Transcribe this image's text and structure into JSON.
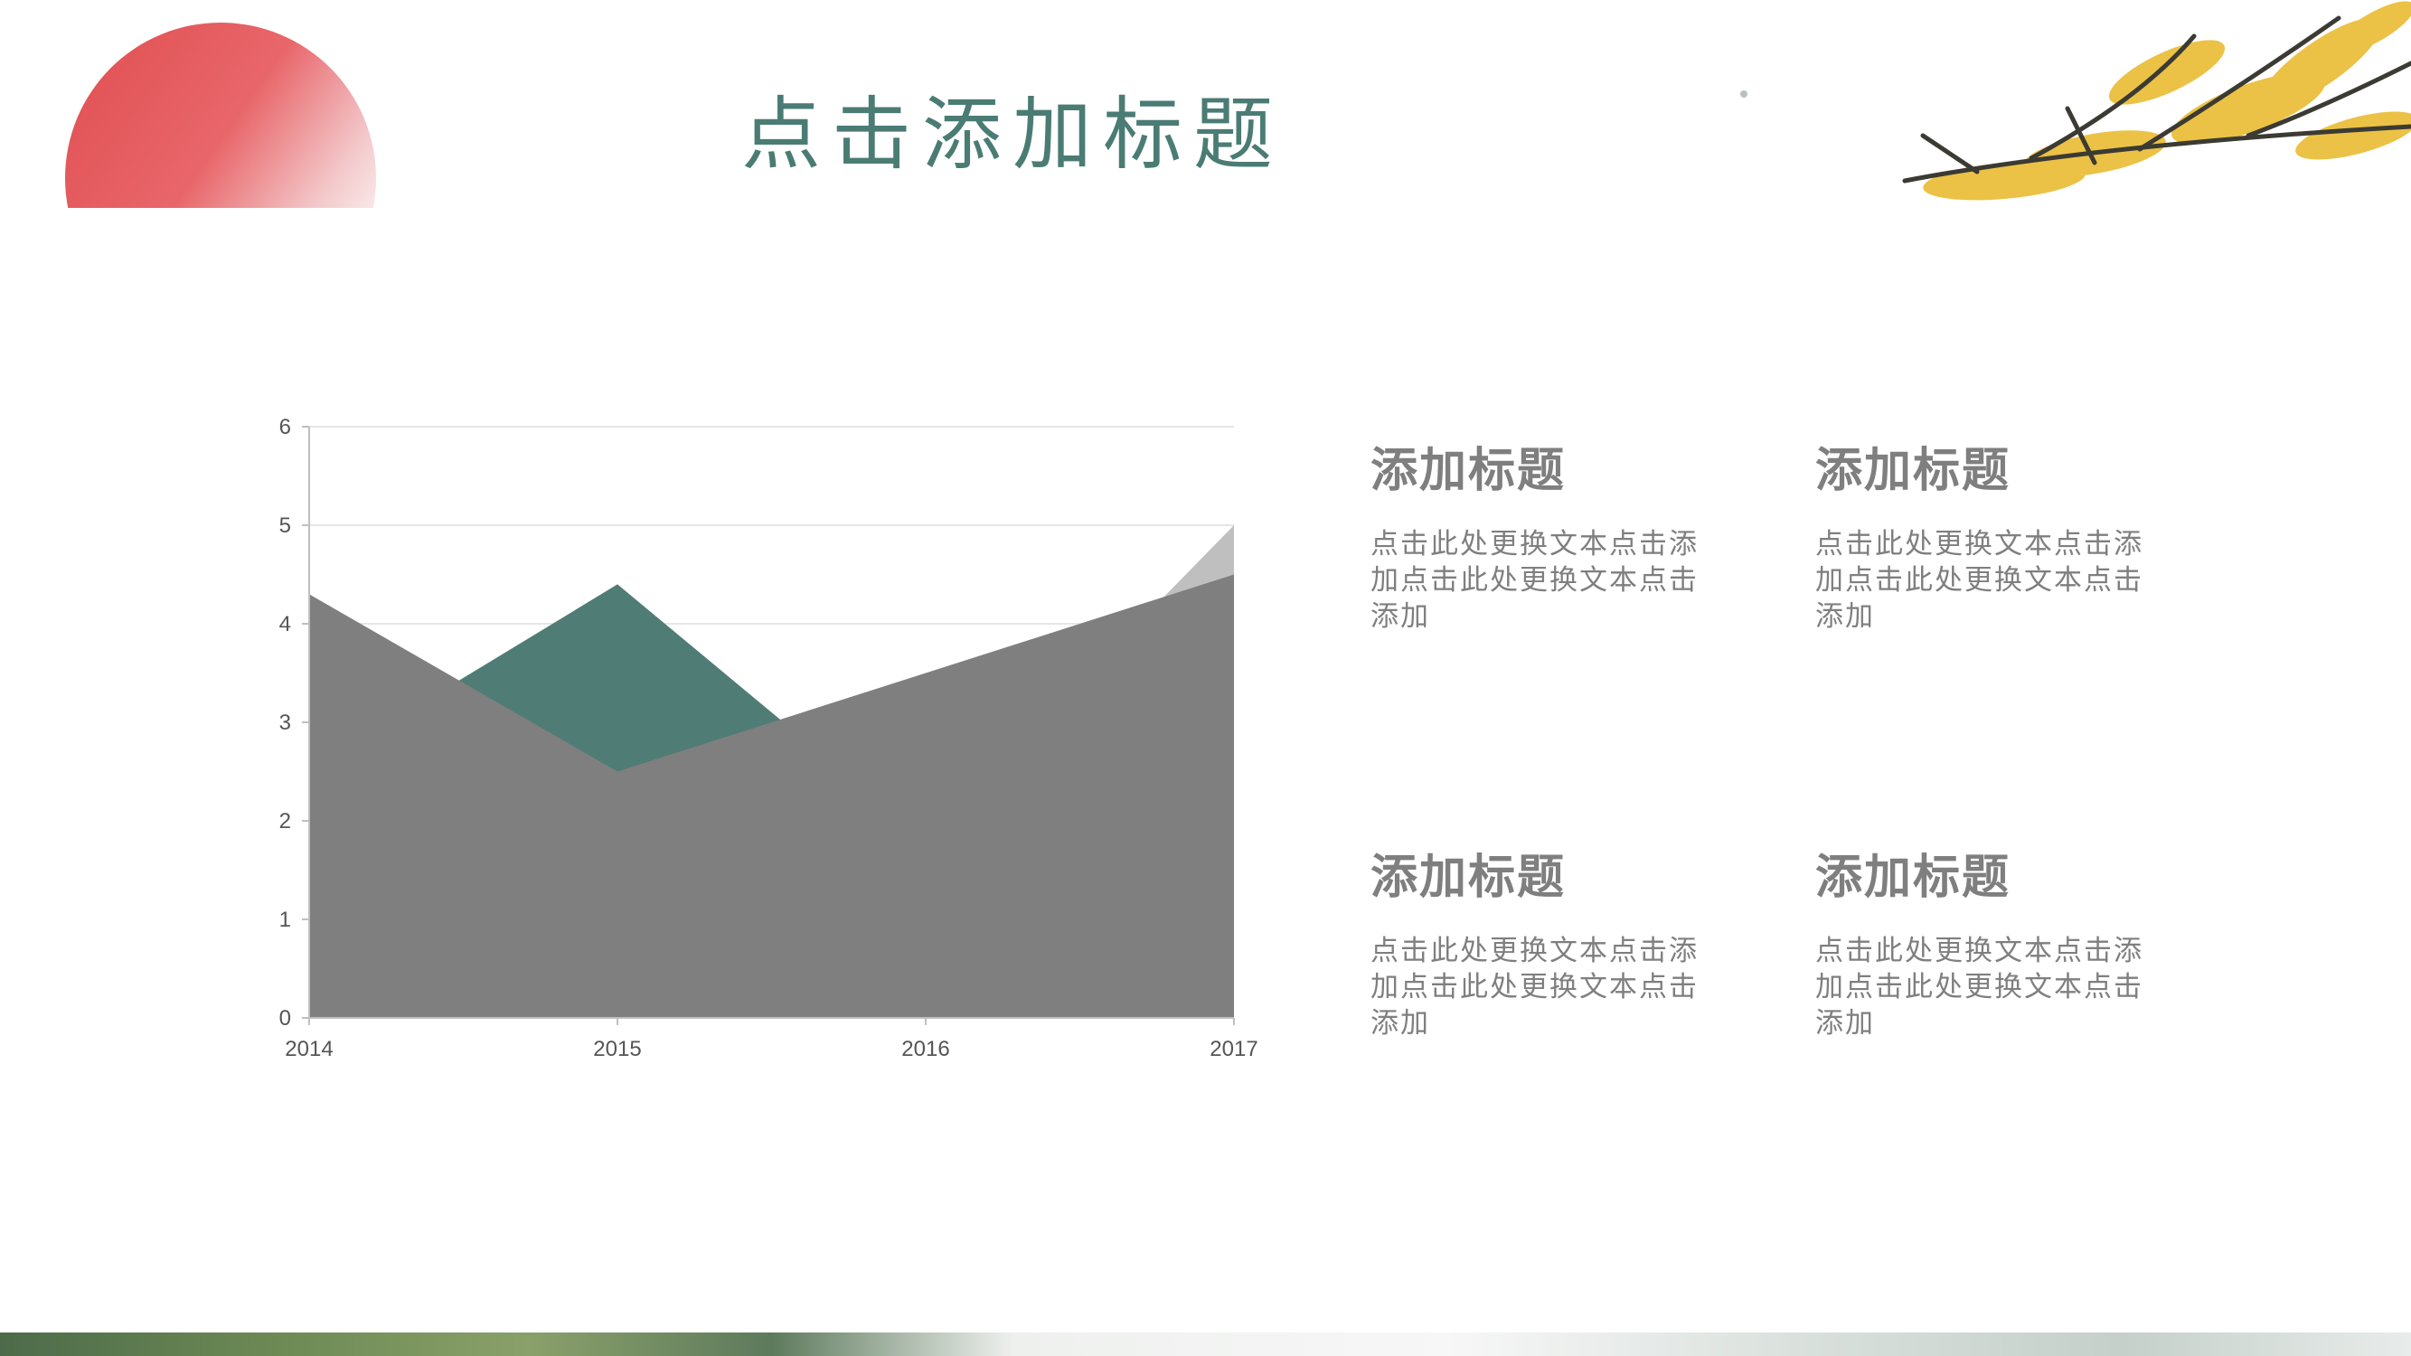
{
  "slide": {
    "title": "点击添加标题"
  },
  "decor": {
    "sun": "red-sun-icon",
    "branch": "yellow-leaf-branch-icon",
    "colors": {
      "sun": "#e04e50",
      "branch_leaf": "#e8b825",
      "branch_stem": "#3b3a33"
    }
  },
  "chart_data": {
    "type": "area",
    "categories": [
      "2014",
      "2015",
      "2016",
      "2017"
    ],
    "x": [
      2014,
      2015,
      2016,
      2017
    ],
    "ylim": [
      0,
      6
    ],
    "yticks": [
      0,
      1,
      2,
      3,
      4,
      5,
      6
    ],
    "grid": true,
    "legend": "none",
    "series": [
      {
        "values": [
          2.4,
          4.4,
          1.8,
          5.0
        ],
        "color": "#bfbfbf"
      },
      {
        "values": [
          2.5,
          4.4,
          1.8,
          2.8
        ],
        "color": "#507c76"
      },
      {
        "values": [
          4.3,
          2.5,
          3.5,
          4.5
        ],
        "color": "#7f7f7f"
      }
    ]
  },
  "info_blocks": [
    {
      "title": "添加标题",
      "text": "点击此处更换文本点击添加点击此处更换文本点击添加"
    },
    {
      "title": "添加标题",
      "text": "点击此处更换文本点击添加点击此处更换文本点击添加"
    },
    {
      "title": "添加标题",
      "text": "点击此处更换文本点击添加点击此处更换文本点击添加"
    },
    {
      "title": "添加标题",
      "text": "点击此处更换文本点击添加点击此处更换文本点击添加"
    }
  ]
}
